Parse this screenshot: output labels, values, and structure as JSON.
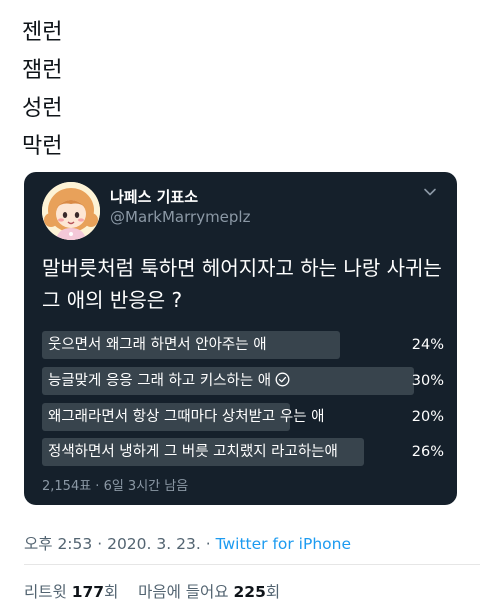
{
  "tweet": {
    "lines": [
      "젠런",
      "잼런",
      "성런",
      "막런"
    ]
  },
  "quote": {
    "display_name": "나페스 기표소",
    "handle": "@MarkMarrymeplz",
    "avatar_icon": "cartoon-girl-avatar",
    "menu_icon": "chevron-down-icon",
    "question": "말버릇처럼 툭하면 헤어지자고 하는 나랑 사귀는 그 애의 반응은 ?",
    "poll": {
      "options": [
        {
          "label": "웃으면서 왜그래 하면서 안아주는 애",
          "percent_text": "24%",
          "value": 24,
          "selected": false
        },
        {
          "label": "능글맞게 응응 그래 하고 키스하는 애",
          "percent_text": "30%",
          "value": 30,
          "selected": true
        },
        {
          "label": "왜그래라면서 항상 그때마다 상처받고 우는 애",
          "percent_text": "20%",
          "value": 20,
          "selected": false
        },
        {
          "label": "정색하면서 냉하게 그 버릇 고치랬지 라고하는애",
          "percent_text": "26%",
          "value": 26,
          "selected": false
        }
      ],
      "meta": "2,154표 · 6일 3시간 남음"
    }
  },
  "timestamp": {
    "time": "오후 2:53",
    "date": "2020. 3. 23.",
    "separator": "·",
    "source": "Twitter for iPhone"
  },
  "stats": {
    "retweets_label": "리트윗",
    "retweets_count": "177",
    "retweets_unit": "회",
    "likes_label": "마음에 들어요",
    "likes_count": "225",
    "likes_unit": "회"
  },
  "colors": {
    "card_bg": "#15202b",
    "bar": "#38444d",
    "link": "#1d9bf0",
    "muted": "#8b98a5"
  }
}
